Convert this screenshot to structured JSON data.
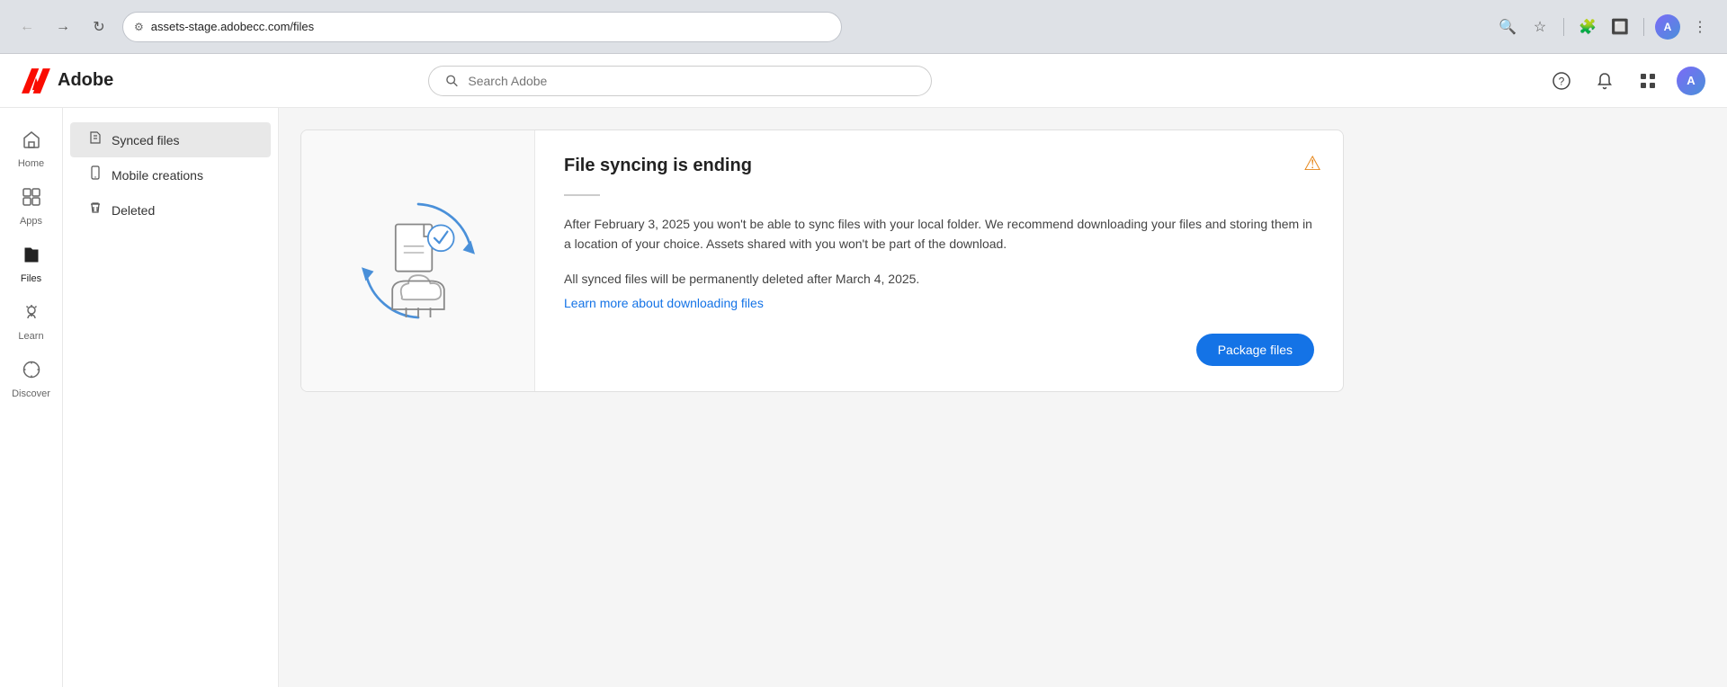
{
  "browser": {
    "back_disabled": true,
    "forward_disabled": false,
    "url": "assets-stage.adobecc.com/files",
    "url_icon": "🔒"
  },
  "header": {
    "logo_text": "Adobe",
    "search_placeholder": "Search Adobe",
    "help_icon": "help-icon",
    "notifications_icon": "bell-icon",
    "apps_icon": "apps-icon",
    "profile_initials": "A"
  },
  "left_nav": {
    "items": [
      {
        "id": "home",
        "label": "Home",
        "icon": "🏠",
        "active": false
      },
      {
        "id": "apps",
        "label": "Apps",
        "icon": "⊞",
        "active": false
      },
      {
        "id": "files",
        "label": "Files",
        "icon": "📁",
        "active": true
      },
      {
        "id": "learn",
        "label": "Learn",
        "icon": "💡",
        "active": false
      },
      {
        "id": "discover",
        "label": "Discover",
        "icon": "🔍",
        "active": false
      }
    ]
  },
  "sidebar": {
    "items": [
      {
        "id": "synced-files",
        "label": "Synced files",
        "icon": "📄",
        "active": true
      },
      {
        "id": "mobile-creations",
        "label": "Mobile creations",
        "icon": "📱",
        "active": false
      },
      {
        "id": "deleted",
        "label": "Deleted",
        "icon": "🗑",
        "active": false
      }
    ]
  },
  "alert": {
    "title": "File syncing is ending",
    "separator": true,
    "body_text": "After February 3, 2025 you won't be able to sync files with your local folder. We recommend downloading your files and storing them in a location of your choice. Assets shared with you won't be part of the download.",
    "subtext": "All synced files will be permanently deleted after March 4, 2025.",
    "link_text": "Learn more about downloading files",
    "link_href": "#",
    "warning_icon": "⚠",
    "package_button_label": "Package files"
  }
}
